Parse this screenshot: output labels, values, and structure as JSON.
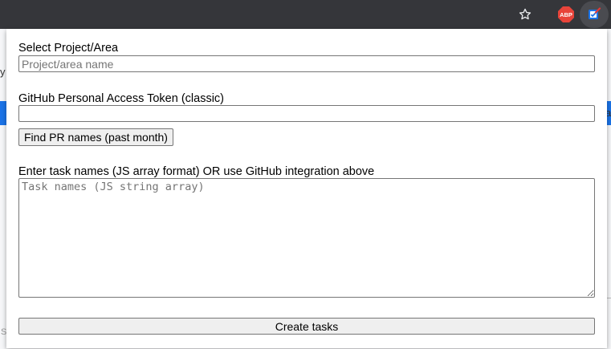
{
  "browser": {
    "toolbar_icons": [
      "star-icon",
      "adblock-plus-icon",
      "task-extension-icon"
    ],
    "abp_label": "ABP",
    "colors": {
      "toolbar_bg": "#35363a",
      "abp_red": "#e8443a",
      "task_blue": "#1a73e8",
      "task_red": "#e53935"
    }
  },
  "underlay": {
    "left_glyph": "y",
    "right_glyph": "a",
    "bottom_left_glyph": "S"
  },
  "form": {
    "project": {
      "label": "Select Project/Area",
      "placeholder": "Project/area name",
      "value": ""
    },
    "token": {
      "label": "GitHub Personal Access Token (classic)",
      "value": ""
    },
    "find_pr_button": "Find PR names (past month)",
    "tasks": {
      "label": "Enter task names (JS array format) OR use GitHub integration above",
      "placeholder": "Task names (JS string array)",
      "value": ""
    },
    "create_button": "Create tasks"
  }
}
